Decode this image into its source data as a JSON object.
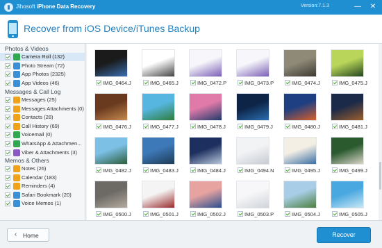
{
  "app": {
    "brand_prefix": "Jihosoft",
    "brand_name": "iPhone Data Recovery",
    "version": "Version:7.1.3",
    "minimize_glyph": "—",
    "close_glyph": "✕"
  },
  "header": {
    "title": "Recover from iOS Device/iTunes Backup",
    "icon": "phone-icon"
  },
  "sidebar": {
    "sections": [
      {
        "title": "Photos & Videos",
        "items": [
          {
            "label": "Camera Roll (132)",
            "icon": "camera-roll-icon",
            "color": "#2fa84f",
            "checked": true,
            "selected": true
          },
          {
            "label": "Photo Stream (72)",
            "icon": "photo-stream-icon",
            "color": "#3b8fd6",
            "checked": true,
            "selected": false
          },
          {
            "label": "App Photos (2325)",
            "icon": "app-photos-icon",
            "color": "#3b8fd6",
            "checked": true,
            "selected": false
          },
          {
            "label": "App Videos (46)",
            "icon": "app-videos-icon",
            "color": "#3b8fd6",
            "checked": true,
            "selected": false
          }
        ]
      },
      {
        "title": "Messages & Call Log",
        "items": [
          {
            "label": "Messages (25)",
            "icon": "messages-icon",
            "color": "#f0a21a",
            "checked": true,
            "selected": false
          },
          {
            "label": "Messages Attachments (0)",
            "icon": "attachments-icon",
            "color": "#f0a21a",
            "checked": true,
            "selected": false
          },
          {
            "label": "Contacts (28)",
            "icon": "contacts-icon",
            "color": "#f0a21a",
            "checked": true,
            "selected": false
          },
          {
            "label": "Call History (69)",
            "icon": "call-history-icon",
            "color": "#f0a21a",
            "checked": true,
            "selected": false
          },
          {
            "label": "Voicemail (0)",
            "icon": "voicemail-icon",
            "color": "#2fa84f",
            "checked": true,
            "selected": false
          },
          {
            "label": "WhatsApp & Attachmen...",
            "icon": "whatsapp-icon",
            "color": "#2fa84f",
            "checked": true,
            "selected": false
          },
          {
            "label": "Viber & Attachments (3)",
            "icon": "viber-icon",
            "color": "#8a5bc4",
            "checked": true,
            "selected": false
          }
        ]
      },
      {
        "title": "Memos & Others",
        "items": [
          {
            "label": "Notes (26)",
            "icon": "notes-icon",
            "color": "#f0a21a",
            "checked": true,
            "selected": false
          },
          {
            "label": "Calendar (183)",
            "icon": "calendar-icon",
            "color": "#f0a21a",
            "checked": true,
            "selected": false
          },
          {
            "label": "Reminders (4)",
            "icon": "reminders-icon",
            "color": "#f0a21a",
            "checked": true,
            "selected": false
          },
          {
            "label": "Safari Bookmark (20)",
            "icon": "safari-icon",
            "color": "#3b8fd6",
            "checked": true,
            "selected": false
          },
          {
            "label": "Voice Memos (1)",
            "icon": "voice-memos-icon",
            "color": "#3b8fd6",
            "checked": true,
            "selected": false
          }
        ]
      }
    ]
  },
  "photos": [
    {
      "name": "IMG_0464.J",
      "colors": [
        "#1b1b1b",
        "#3a6fb0"
      ]
    },
    {
      "name": "IMG_0465.J",
      "colors": [
        "#ffffff",
        "#444444"
      ]
    },
    {
      "name": "IMG_0472.P",
      "colors": [
        "#f7f7fb",
        "#7b5fb6"
      ]
    },
    {
      "name": "IMG_0473.P",
      "colors": [
        "#f7f7fb",
        "#7b5fb6"
      ]
    },
    {
      "name": "IMG_0474.J",
      "colors": [
        "#8f8a78",
        "#3d3a33"
      ]
    },
    {
      "name": "IMG_0475.J",
      "colors": [
        "#b9d65a",
        "#24451f"
      ]
    },
    {
      "name": "IMG_0476.J",
      "colors": [
        "#6a3a1f",
        "#c58a4e"
      ]
    },
    {
      "name": "IMG_0477.J",
      "colors": [
        "#56b6e0",
        "#2e7d3a"
      ]
    },
    {
      "name": "IMG_0478.J",
      "colors": [
        "#e07aa9",
        "#1f3a6b"
      ]
    },
    {
      "name": "IMG_0479.J",
      "colors": [
        "#0d2447",
        "#2a6fb0"
      ]
    },
    {
      "name": "IMG_0480.J",
      "colors": [
        "#1e3f82",
        "#d85f2a"
      ]
    },
    {
      "name": "IMG_0481.J",
      "colors": [
        "#1c2a4a",
        "#9b5e2a"
      ]
    },
    {
      "name": "IMG_0482.J",
      "colors": [
        "#7cc0e6",
        "#2c5e3c"
      ]
    },
    {
      "name": "IMG_0483.J",
      "colors": [
        "#3d78b8",
        "#1e3b55"
      ]
    },
    {
      "name": "IMG_0484.J",
      "colors": [
        "#1d2f5e",
        "#b8c7dd"
      ]
    },
    {
      "name": "IMG_0494.N",
      "colors": [
        "#f2f3f5",
        "#c7ccd3"
      ]
    },
    {
      "name": "IMG_0495.J",
      "colors": [
        "#f4efe5",
        "#3a6fa5"
      ]
    },
    {
      "name": "IMG_0499.J",
      "colors": [
        "#2b5a2f",
        "#d9d4c8"
      ]
    },
    {
      "name": "IMG_0500.J",
      "colors": [
        "#6d6a66",
        "#b4ab9e"
      ]
    },
    {
      "name": "IMG_0501.J",
      "colors": [
        "#f4f4f4",
        "#9b2b2b"
      ]
    },
    {
      "name": "IMG_0502.J",
      "colors": [
        "#e7a3a0",
        "#2a4f8f"
      ]
    },
    {
      "name": "IMG_0503.P",
      "colors": [
        "#f7f7f9",
        "#d0d4da"
      ]
    },
    {
      "name": "IMG_0504.J",
      "colors": [
        "#a8cde6",
        "#4b7f3c"
      ]
    },
    {
      "name": "IMG_0505.J",
      "colors": [
        "#4aa8e0",
        "#c7e7f5"
      ]
    }
  ],
  "footer": {
    "home_label": "Home",
    "home_glyph": "‹",
    "recover_label": "Recover"
  },
  "colors": {
    "titlebar": "#1f8fd1",
    "accent": "#1f8fd1",
    "selected_row": "#d8e8f6",
    "checkmark": "#41a62f"
  }
}
